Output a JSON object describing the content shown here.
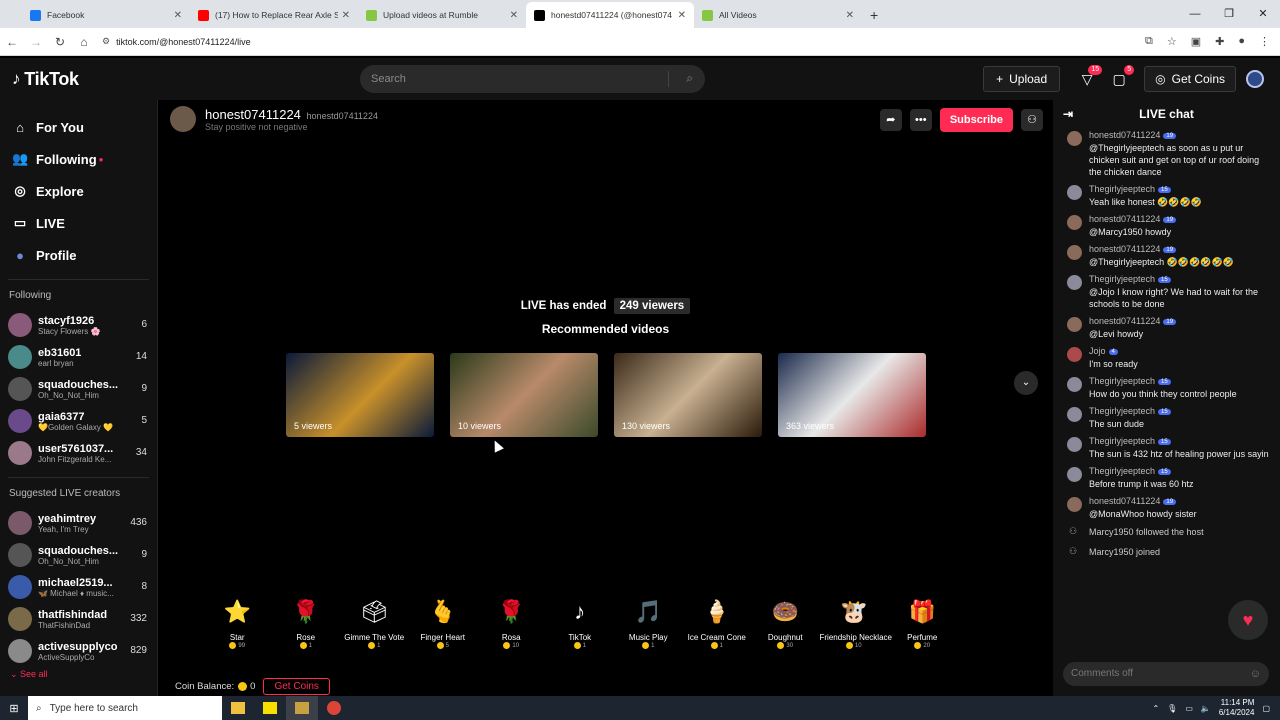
{
  "browser": {
    "tabs": [
      {
        "title": "Facebook",
        "color": "#1877f2",
        "active": false
      },
      {
        "title": "(17) How to Replace Rear Axle S",
        "color": "#ff0000",
        "active": false
      },
      {
        "title": "Upload videos at Rumble",
        "color": "#85c742",
        "active": false
      },
      {
        "title": "honestd07411224 (@honest074",
        "color": "#000000",
        "active": true
      },
      {
        "title": "All Videos",
        "color": "#85c742",
        "active": false
      }
    ],
    "new_tab": "+",
    "url": "tiktok.com/@honest07411224/live"
  },
  "header": {
    "logo": "TikTok",
    "search_placeholder": "Search",
    "upload_label": "Upload",
    "inbox_badge": "15",
    "messages_badge": "5",
    "get_coins_label": "Get Coins"
  },
  "sidebar": {
    "nav": [
      {
        "label": "For You",
        "icon": "home-icon",
        "glyph": "⌂"
      },
      {
        "label": "Following",
        "icon": "following-icon",
        "glyph": "👥"
      },
      {
        "label": "Explore",
        "icon": "compass-icon",
        "glyph": "◎"
      },
      {
        "label": "LIVE",
        "icon": "live-icon",
        "glyph": "▭"
      },
      {
        "label": "Profile",
        "icon": "avatar-icon",
        "glyph": "●"
      }
    ],
    "following_heading": "Following",
    "following": [
      {
        "name": "stacyf1926",
        "sub": "Stacy Flowers 🌸",
        "count": "6",
        "color": "#8a5a7a"
      },
      {
        "name": "eb31601",
        "sub": "earl bryan",
        "count": "14",
        "color": "#4a8a8a"
      },
      {
        "name": "squadouches...",
        "sub": "Oh_No_Not_Him",
        "count": "9",
        "color": "#555555"
      },
      {
        "name": "gaia6377",
        "sub": "💛Golden Galaxy 💛",
        "count": "5",
        "color": "#6a4a8a"
      },
      {
        "name": "user5761037...",
        "sub": "John Fitzgerald Ke...",
        "count": "34",
        "color": "#9a7a8a"
      }
    ],
    "suggested_heading": "Suggested LIVE creators",
    "suggested": [
      {
        "name": "yeahimtrey",
        "sub": "Yeah, I'm Trey",
        "count": "436",
        "color": "#7a5a6a"
      },
      {
        "name": "squadouches...",
        "sub": "Oh_No_Not_Him",
        "count": "9",
        "color": "#555555"
      },
      {
        "name": "michael2519...",
        "sub": "🦋 Michael ♦ music...",
        "count": "8",
        "color": "#3a5aaa"
      },
      {
        "name": "thatfishindad",
        "sub": "ThatFishinDad",
        "count": "332",
        "color": "#7a6a4a"
      },
      {
        "name": "activesupplyco",
        "sub": "ActiveSupplyCo",
        "count": "829",
        "color": "#8a8a8a"
      }
    ],
    "see_all": "See all"
  },
  "main": {
    "host_name": "honest07411224",
    "host_handle": "honestd07411224",
    "host_bio": "Stay positive not negative",
    "subscribe_label": "Subscribe",
    "ended_text": "LIVE has ended",
    "ended_viewers": "249 viewers",
    "recommended_heading": "Recommended videos",
    "recommended": [
      {
        "viewers": "5 viewers",
        "bg": "linear-gradient(135deg,#0a1a3a,#c8902a 55%,#0a1a3a)"
      },
      {
        "viewers": "10 viewers",
        "bg": "linear-gradient(135deg,#2a3a1a,#b88a6a 50%,#3a4a2a)"
      },
      {
        "viewers": "130 viewers",
        "bg": "linear-gradient(135deg,#3a2a1a,#c8b090 50%,#2a1a0a)"
      },
      {
        "viewers": "363 viewers",
        "bg": "linear-gradient(135deg,#1a2a4a,#e8e8e8 50%,#aa2a2a)"
      }
    ],
    "gifts": [
      {
        "name": "Star",
        "price": "99",
        "glyph": "⭐"
      },
      {
        "name": "Rose",
        "price": "1",
        "glyph": "🌹"
      },
      {
        "name": "Gimme The Vote",
        "price": "1",
        "glyph": "🗳"
      },
      {
        "name": "Finger Heart",
        "price": "5",
        "glyph": "🫰"
      },
      {
        "name": "Rosa",
        "price": "10",
        "glyph": "🌹"
      },
      {
        "name": "TikTok",
        "price": "1",
        "glyph": "♪"
      },
      {
        "name": "Music Play",
        "price": "1",
        "glyph": "🎵"
      },
      {
        "name": "Ice Cream Cone",
        "price": "1",
        "glyph": "🍦"
      },
      {
        "name": "Doughnut",
        "price": "30",
        "glyph": "🍩"
      },
      {
        "name": "Friendship Necklace",
        "price": "10",
        "glyph": "🐮"
      },
      {
        "name": "Perfume",
        "price": "20",
        "glyph": "🎁"
      }
    ],
    "coin_balance_label": "Coin Balance:",
    "coin_balance": "0",
    "get_coins_label": "Get Coins"
  },
  "chat": {
    "title": "LIVE chat",
    "messages": [
      {
        "user": "honestd07411224",
        "level": "19",
        "text": "@Thegirlyjeeptech as soon as u put ur chicken suit and get on top of ur roof doing the chicken dance"
      },
      {
        "user": "Thegirlyjeeptech",
        "level": "15",
        "text": "Yeah like honest 🤣🤣🤣🤣"
      },
      {
        "user": "honestd07411224",
        "level": "19",
        "text": "@Marcy1950 howdy"
      },
      {
        "user": "honestd07411224",
        "level": "19",
        "text": "@Thegirlyjeeptech 🤣🤣🤣🤣🤣🤣"
      },
      {
        "user": "Thegirlyjeeptech",
        "level": "15",
        "text": "@Jojo I know right? We had to wait for the schools to be done"
      },
      {
        "user": "honestd07411224",
        "level": "19",
        "text": "@Levi howdy"
      },
      {
        "user": "Jojo",
        "level": "4",
        "text": "I'm so ready"
      },
      {
        "user": "Thegirlyjeeptech",
        "level": "15",
        "text": "How do you think they control people"
      },
      {
        "user": "Thegirlyjeeptech",
        "level": "15",
        "text": "The sun dude"
      },
      {
        "user": "Thegirlyjeeptech",
        "level": "15",
        "text": "The sun is 432 htz of healing power jus sayin"
      },
      {
        "user": "Thegirlyjeeptech",
        "level": "15",
        "text": "Before trump it was 60 htz"
      },
      {
        "user": "honestd07411224",
        "level": "19",
        "text": "@MonaWhoo howdy sister"
      }
    ],
    "system": [
      {
        "text": "Marcy1950 followed the host"
      },
      {
        "text": "Marcy1950 joined"
      }
    ],
    "comment_placeholder": "Comments off"
  },
  "taskbar": {
    "search_placeholder": "Type here to search",
    "time": "11:14 PM",
    "date": "6/14/2024"
  }
}
